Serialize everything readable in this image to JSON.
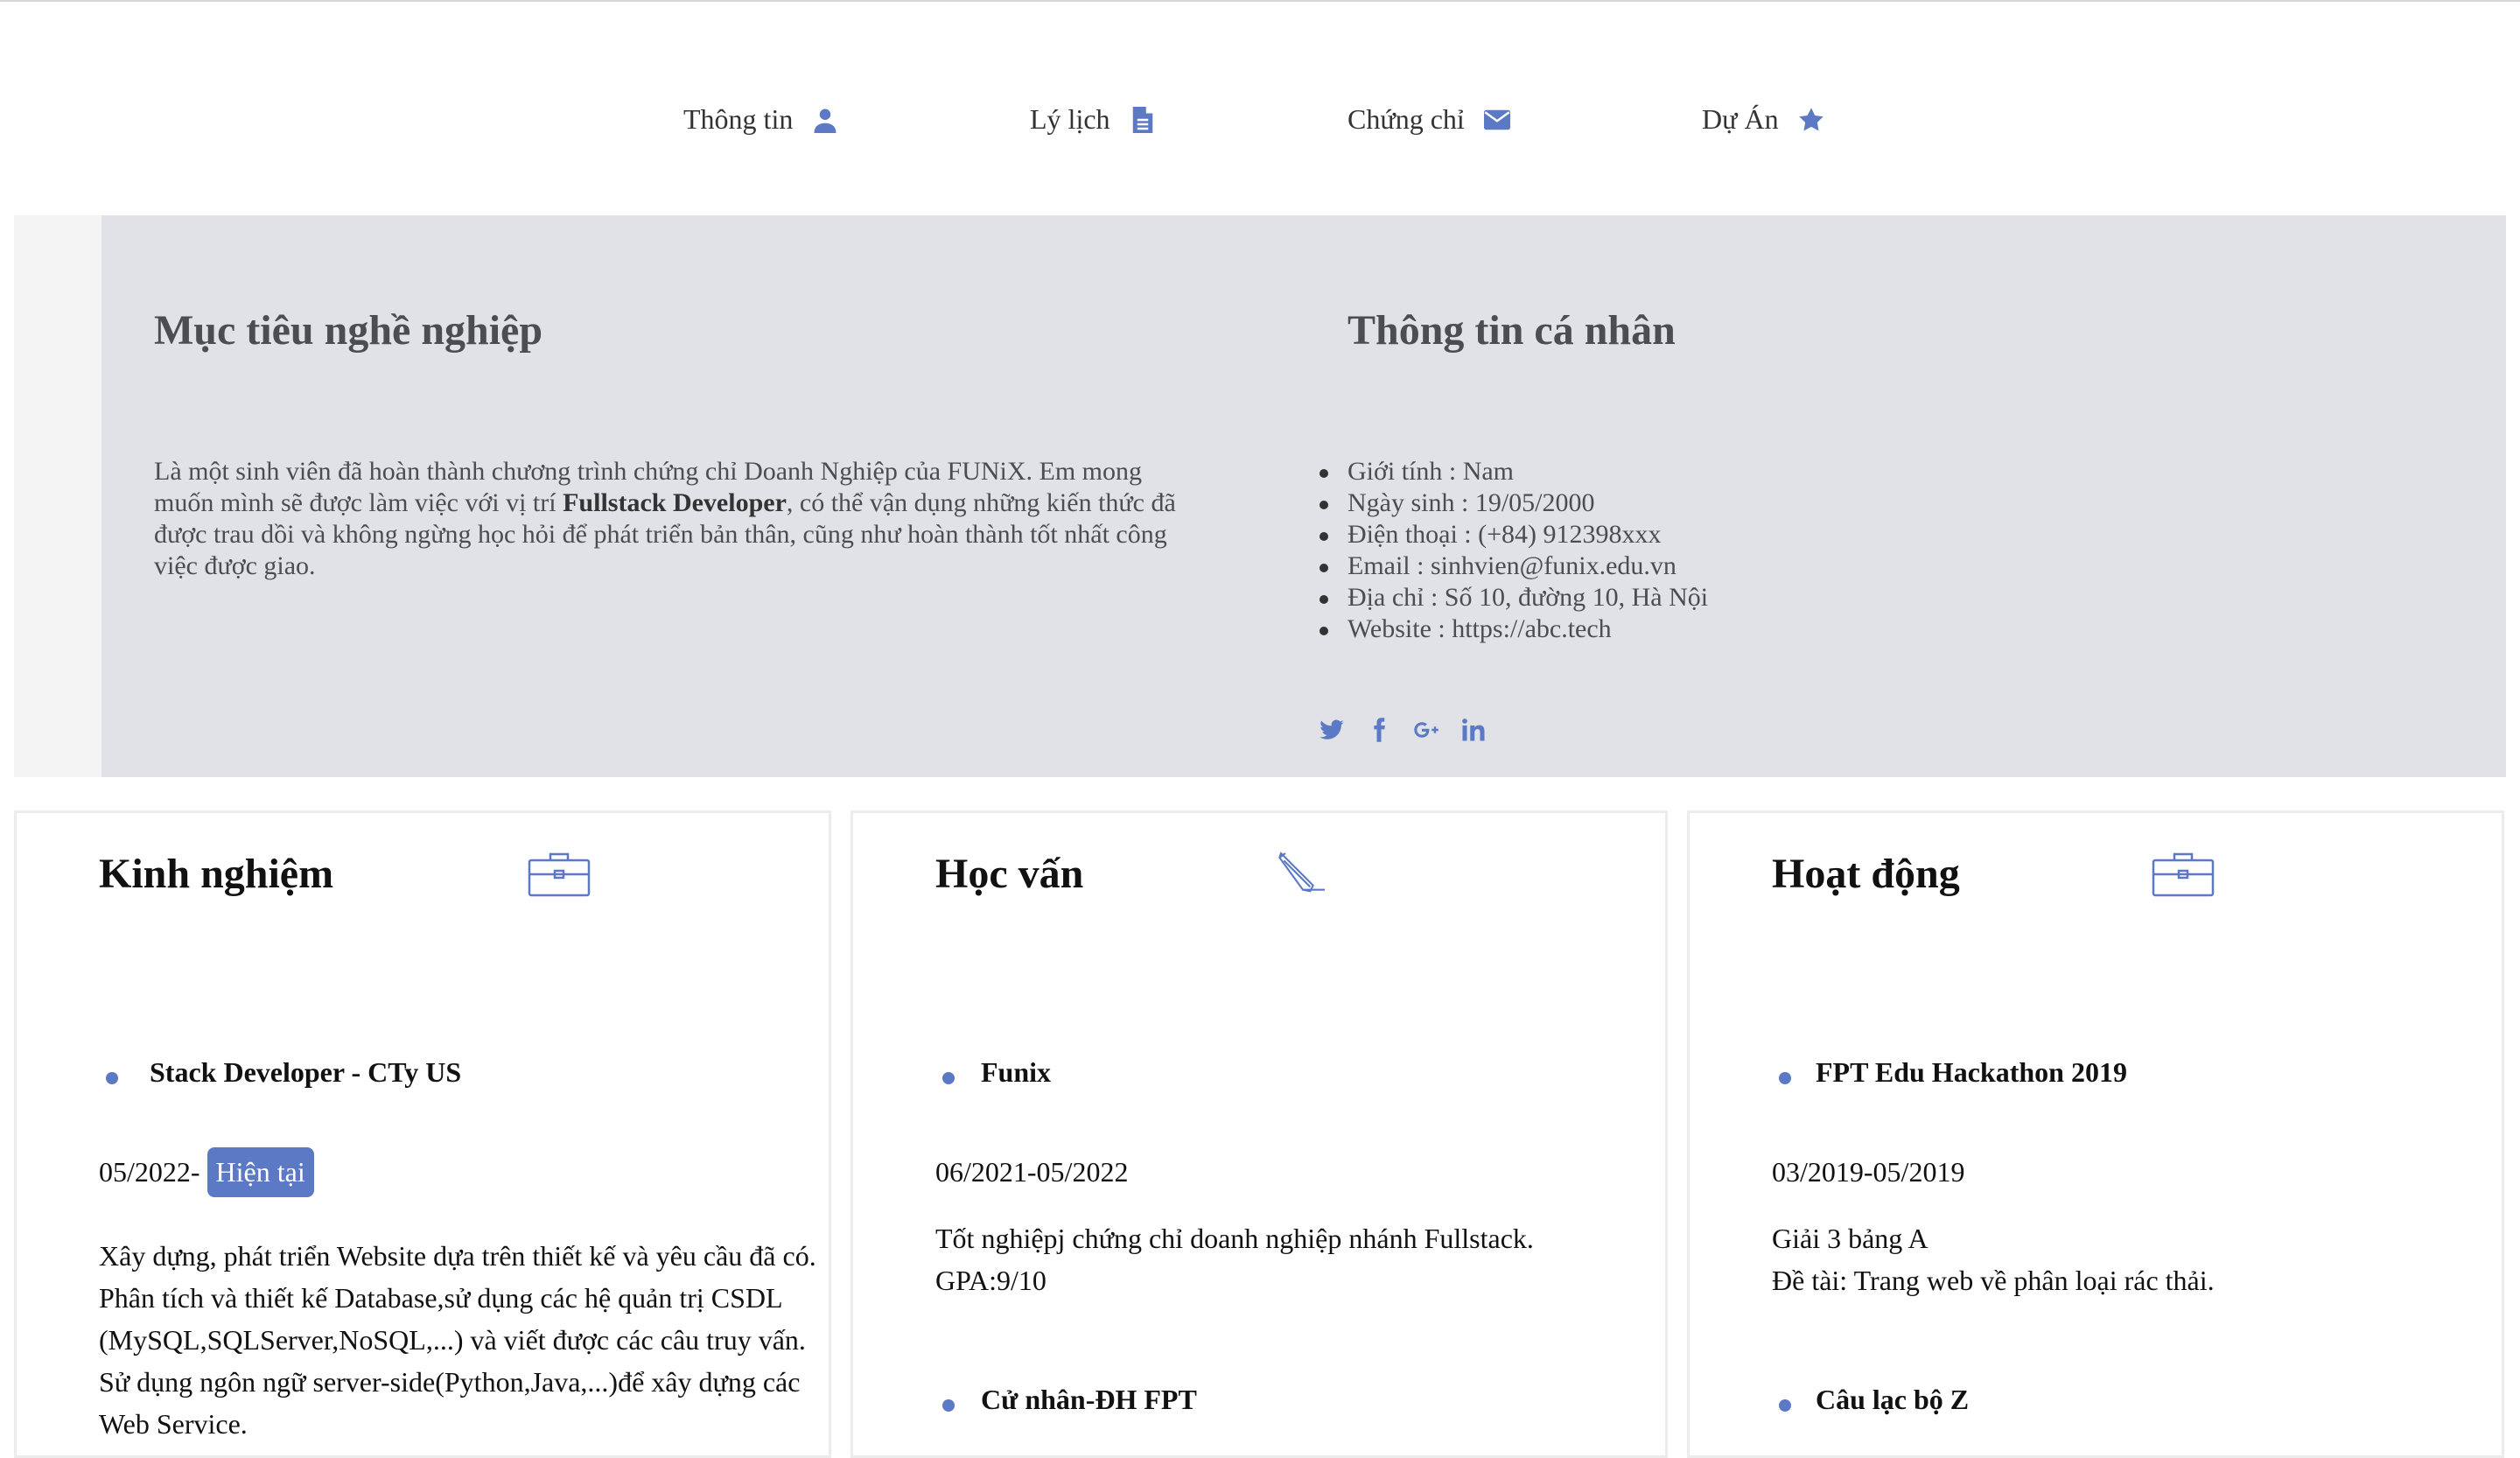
{
  "nav": [
    {
      "label": "Thông tin",
      "icon": "user-icon"
    },
    {
      "label": "Lý lịch",
      "icon": "document-icon"
    },
    {
      "label": "Chứng chỉ",
      "icon": "envelope-icon"
    },
    {
      "label": "Dự Án",
      "icon": "star-icon"
    }
  ],
  "objective": {
    "title": "Mục tiêu nghề nghiệp",
    "text_before": "Là một sinh viên đã hoàn thành chương trình chứng chỉ Doanh Nghiệp của FUNiX. Em mong muốn mình sẽ được làm việc với vị trí ",
    "highlight": "Fullstack Developer",
    "text_after": ", có thể vận dụng những kiến thức đã được trau dồi và không ngừng học hỏi để phát triển bản thân, cũng như hoàn thành tốt nhất công việc được giao."
  },
  "personal": {
    "title": "Thông tin cá nhân",
    "items": [
      "Giới tính : Nam",
      "Ngày sinh : 19/05/2000",
      "Điện thoại : (+84) 912398xxx",
      "Email : sinhvien@funix.edu.vn",
      "Địa chỉ : Số 10, đường 10, Hà Nội",
      "Website : https://abc.tech"
    ],
    "social": [
      "twitter-icon",
      "facebook-icon",
      "google-plus-icon",
      "linkedin-icon"
    ]
  },
  "experience": {
    "title": "Kinh nghiệm",
    "icon": "briefcase-icon",
    "entry_title": "Stack Developer - CTy US",
    "date": "05/2022-",
    "badge": "Hiện tại",
    "desc": "Xây dựng, phát triển Website dựa trên thiết kế và yêu cầu đã có. Phân tích và thiết kế Database,sử dụng các hệ quản trị CSDL (MySQL,SQLServer,NoSQL,...) và viết được các câu truy vấn. Sử dụng ngôn ngữ server-side(Python,Java,...)để xây dựng các Web Service."
  },
  "education": {
    "title": "Học vấn",
    "icon": "pencil-icon",
    "entry_title": "Funix",
    "date": "06/2021-05/2022",
    "desc_line1": "Tốt nghiệpj chứng chỉ doanh nghiệp nhánh Fullstack.",
    "desc_line2": "GPA:9/10",
    "entry2_title": "Cử nhân-ĐH FPT"
  },
  "activities": {
    "title": "Hoạt động",
    "icon": "briefcase-icon",
    "entry_title": "FPT Edu Hackathon 2019",
    "date": "03/2019-05/2019",
    "desc_line1": "Giải 3 bảng A",
    "desc_line2": "Đề tài: Trang web về phân loại rác thải.",
    "entry2_title": "Câu lạc bộ Z"
  },
  "colors": {
    "accent": "#5b79c5",
    "panel": "#e0e2e7",
    "text": "#4a4d52"
  }
}
